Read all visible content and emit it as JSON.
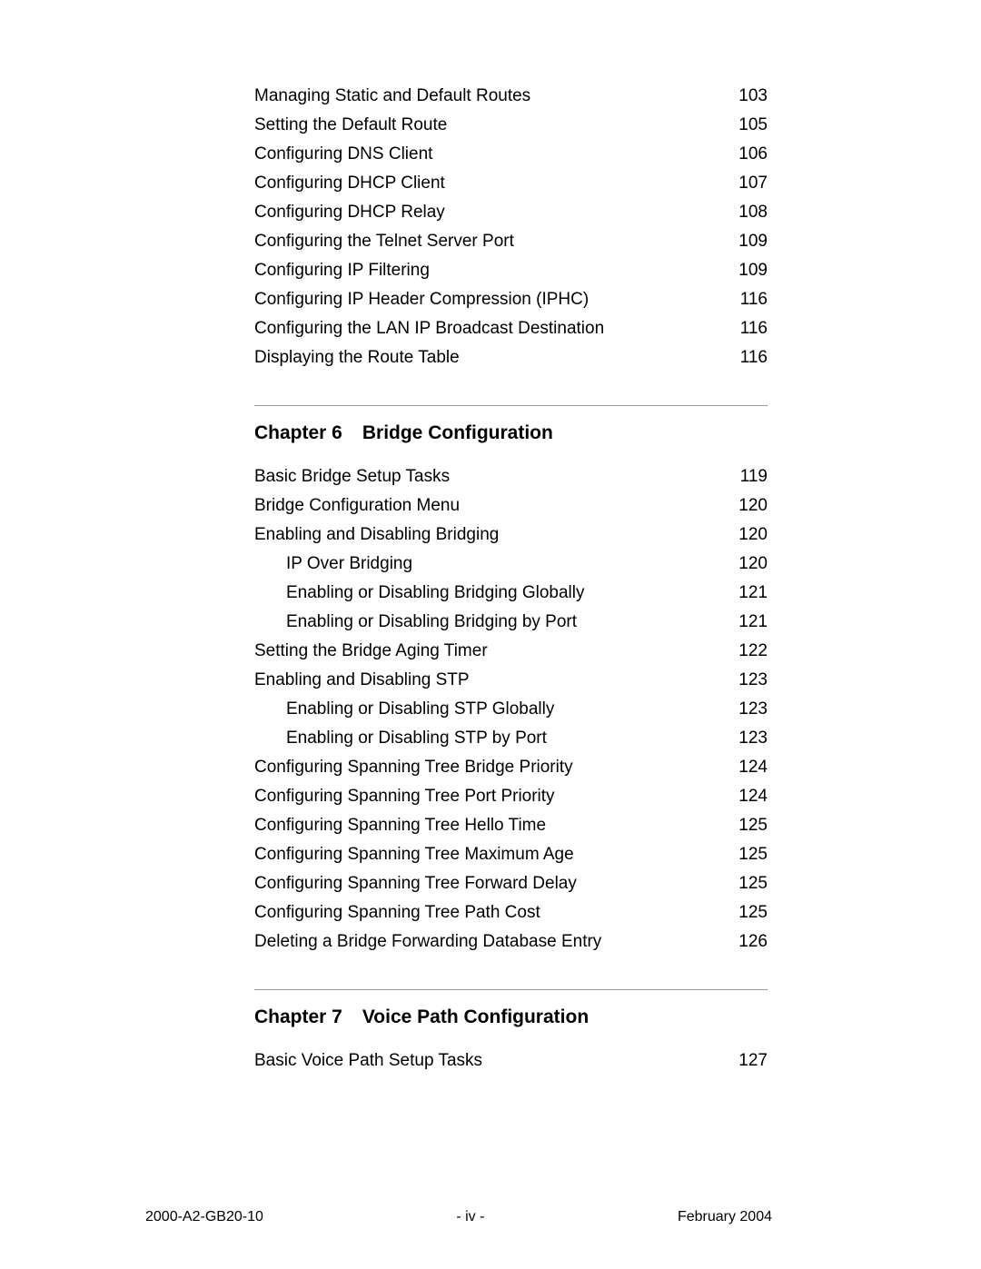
{
  "sections": [
    {
      "heading": null,
      "entries": [
        {
          "title": "Managing Static and Default Routes",
          "page": "103",
          "indent": 0
        },
        {
          "title": "Setting the Default Route",
          "page": "105",
          "indent": 0
        },
        {
          "title": "Configuring DNS Client",
          "page": "106",
          "indent": 0
        },
        {
          "title": "Configuring DHCP Client",
          "page": "107",
          "indent": 0
        },
        {
          "title": "Configuring DHCP Relay",
          "page": "108",
          "indent": 0
        },
        {
          "title": "Configuring the Telnet Server Port",
          "page": "109",
          "indent": 0
        },
        {
          "title": "Configuring IP Filtering",
          "page": "109",
          "indent": 0
        },
        {
          "title": "Configuring IP Header Compression (IPHC)",
          "page": "116",
          "indent": 0
        },
        {
          "title": "Configuring the LAN IP Broadcast Destination",
          "page": "116",
          "indent": 0
        },
        {
          "title": "Displaying the Route Table",
          "page": "116",
          "indent": 0
        }
      ]
    },
    {
      "heading": {
        "chapter": "Chapter 6",
        "title": "Bridge Configuration"
      },
      "entries": [
        {
          "title": "Basic Bridge Setup Tasks",
          "page": "119",
          "indent": 0
        },
        {
          "title": "Bridge Configuration Menu",
          "page": "120",
          "indent": 0
        },
        {
          "title": "Enabling and Disabling Bridging",
          "page": "120",
          "indent": 0
        },
        {
          "title": "IP Over Bridging",
          "page": "120",
          "indent": 1
        },
        {
          "title": "Enabling or Disabling Bridging Globally",
          "page": "121",
          "indent": 1
        },
        {
          "title": "Enabling or Disabling Bridging by Port",
          "page": "121",
          "indent": 1
        },
        {
          "title": "Setting the Bridge Aging Timer",
          "page": "122",
          "indent": 0
        },
        {
          "title": "Enabling and Disabling STP",
          "page": "123",
          "indent": 0
        },
        {
          "title": "Enabling or Disabling STP Globally",
          "page": "123",
          "indent": 1
        },
        {
          "title": "Enabling or Disabling STP by Port",
          "page": "123",
          "indent": 1
        },
        {
          "title": "Configuring Spanning Tree Bridge Priority",
          "page": "124",
          "indent": 0
        },
        {
          "title": "Configuring Spanning Tree Port Priority",
          "page": "124",
          "indent": 0
        },
        {
          "title": "Configuring Spanning Tree Hello Time",
          "page": "125",
          "indent": 0
        },
        {
          "title": "Configuring Spanning Tree Maximum Age",
          "page": "125",
          "indent": 0
        },
        {
          "title": "Configuring Spanning Tree Forward Delay",
          "page": "125",
          "indent": 0
        },
        {
          "title": "Configuring Spanning Tree Path Cost",
          "page": "125",
          "indent": 0
        },
        {
          "title": "Deleting a Bridge Forwarding Database Entry",
          "page": "126",
          "indent": 0
        }
      ]
    },
    {
      "heading": {
        "chapter": "Chapter 7",
        "title": "Voice Path Configuration"
      },
      "entries": [
        {
          "title": "Basic Voice Path Setup Tasks",
          "page": "127",
          "indent": 0
        }
      ]
    }
  ],
  "footer": {
    "left": "2000-A2-GB20-10",
    "center": "- iv -",
    "right": "February 2004"
  }
}
